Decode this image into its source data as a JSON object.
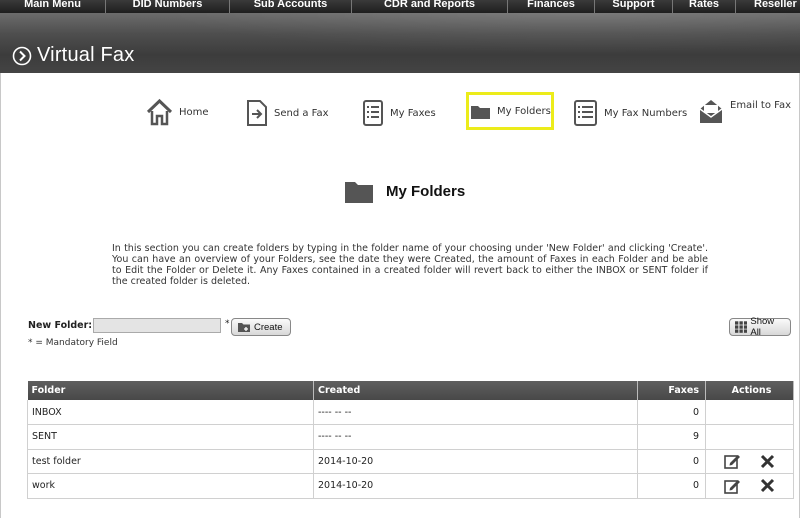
{
  "top_menu": [
    "Main Menu",
    "DID Numbers",
    "Sub Accounts",
    "CDR and Reports",
    "Finances",
    "Support",
    "Rates",
    "Reseller"
  ],
  "banner": {
    "title": "Virtual Fax"
  },
  "subnav": {
    "home": "Home",
    "send_fax": "Send a Fax",
    "my_faxes": "My Faxes",
    "my_folders": "My Folders",
    "my_fax_numbers": "My Fax Numbers",
    "email_to_fax": "Email to Fax",
    "active": "my_folders"
  },
  "page": {
    "title": "My Folders",
    "description": "In this section you can create folders by typing in the folder name of your choosing under 'New Folder' and clicking 'Create'. You can have an overview of your Folders, see the date they were Created, the amount of Faxes in each Folder and be able to Edit the Folder or Delete it. Any Faxes contained in a created folder will revert back to either the INBOX or SENT folder if the created folder is deleted."
  },
  "form": {
    "new_folder_label": "New Folder:",
    "new_folder_value": "",
    "required_marker": "*",
    "create_button": "Create",
    "show_all_button": "Show All",
    "mandatory_note": "* = Mandatory Field"
  },
  "table": {
    "columns": {
      "folder": "Folder",
      "created": "Created",
      "faxes": "Faxes",
      "actions": "Actions"
    },
    "rows": [
      {
        "folder": "INBOX",
        "created": "---- -- --",
        "faxes": "0",
        "editable": false
      },
      {
        "folder": "SENT",
        "created": "---- -- --",
        "faxes": "9",
        "editable": false
      },
      {
        "folder": "test folder",
        "created": "2014-10-20",
        "faxes": "0",
        "editable": true
      },
      {
        "folder": "work",
        "created": "2014-10-20",
        "faxes": "0",
        "editable": true
      }
    ]
  },
  "colors": {
    "highlight": "#ecec1a",
    "header_bg": "#484848",
    "banner_bg": "#4e4e4e"
  }
}
